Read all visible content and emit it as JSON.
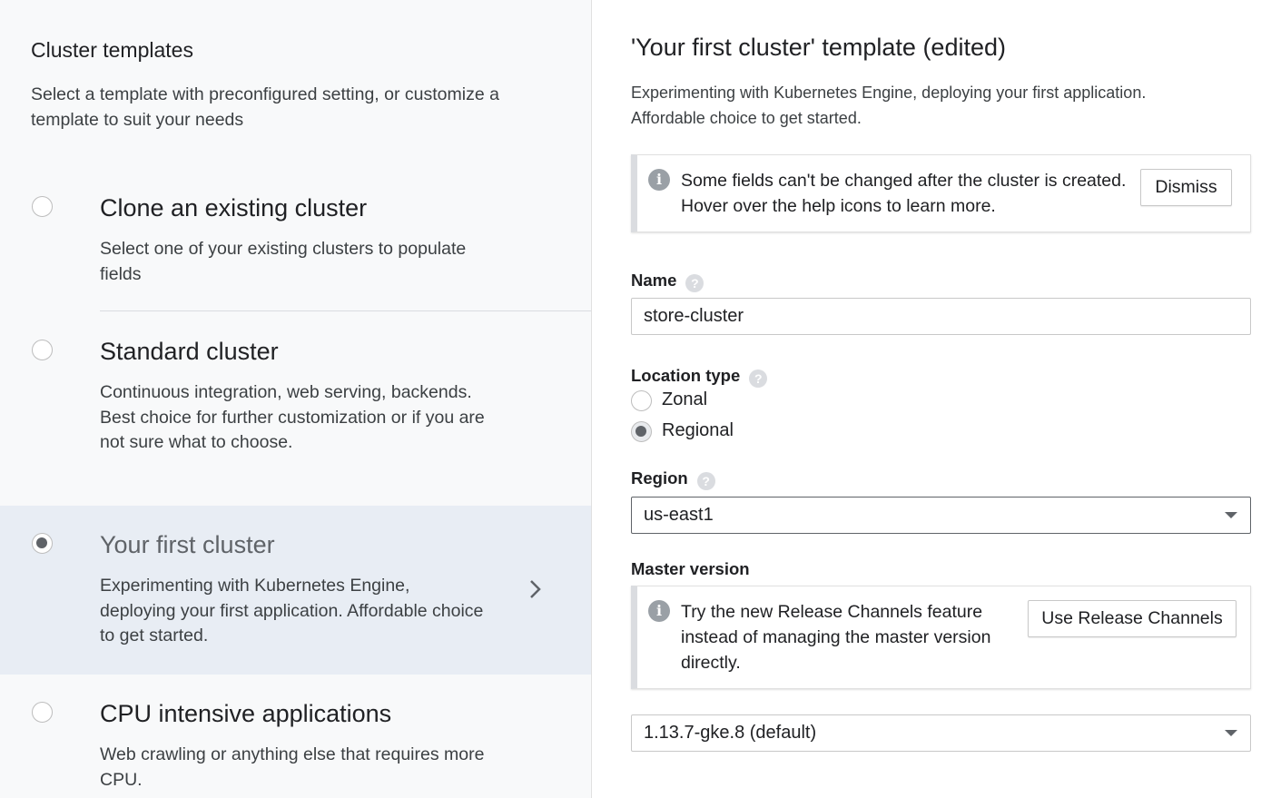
{
  "left": {
    "title": "Cluster templates",
    "description": "Select a template with preconfigured setting, or customize a template to suit your needs",
    "templates": [
      {
        "title": "Clone an existing cluster",
        "description": "Select one of your existing clusters to populate fields",
        "selected": false
      },
      {
        "title": "Standard cluster",
        "description": "Continuous integration, web serving, backends. Best choice for further customization or if you are not sure what to choose.",
        "selected": false
      },
      {
        "title": "Your first cluster",
        "description": "Experimenting with Kubernetes Engine, deploying your first application. Affordable choice to get started.",
        "selected": true
      },
      {
        "title": "CPU intensive applications",
        "description": "Web crawling or anything else that requires more CPU.",
        "selected": false
      }
    ]
  },
  "right": {
    "title": "'Your first cluster' template (edited)",
    "description": "Experimenting with Kubernetes Engine, deploying your first application. Affordable choice to get started.",
    "notice": {
      "text": "Some fields can't be changed after the cluster is created. Hover over the help icons to learn more.",
      "button": "Dismiss"
    },
    "name": {
      "label": "Name",
      "value": "store-cluster"
    },
    "location_type": {
      "label": "Location type",
      "options": [
        {
          "label": "Zonal",
          "selected": false
        },
        {
          "label": "Regional",
          "selected": true
        }
      ]
    },
    "region": {
      "label": "Region",
      "value": "us-east1"
    },
    "master_version": {
      "label": "Master version",
      "notice": {
        "text": "Try the new Release Channels feature instead of managing the master version directly.",
        "button": "Use Release Channels"
      },
      "value": "1.13.7-gke.8 (default)"
    }
  },
  "icons": {
    "info": "info-icon",
    "help": "help-icon",
    "chevron": "chevron-right-icon",
    "dropdown": "dropdown-caret-icon"
  }
}
